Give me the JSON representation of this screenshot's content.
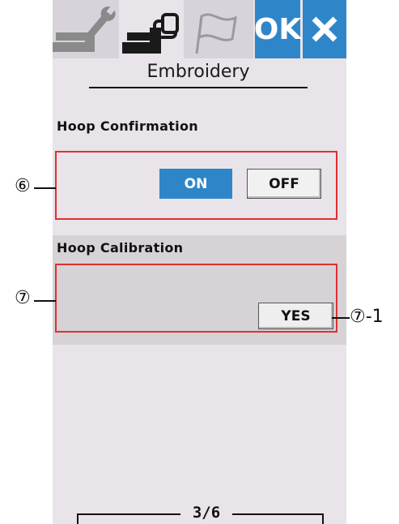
{
  "tabs": [
    {
      "name": "settings-tab",
      "icon": "sewing-machine-wrench-icon",
      "active": false
    },
    {
      "name": "embroidery-tab",
      "icon": "embroidery-machine-icon",
      "active": true
    },
    {
      "name": "language-tab",
      "icon": "flag-icon",
      "active": false
    }
  ],
  "toolbar": {
    "ok_label": "OK",
    "close_icon": "close-icon"
  },
  "page": {
    "title": "Embroidery"
  },
  "hoop_confirmation": {
    "label": "Hoop Confirmation",
    "on_label": "ON",
    "off_label": "OFF",
    "selected": "ON"
  },
  "hoop_calibration": {
    "label": "Hoop Calibration",
    "yes_label": "YES"
  },
  "callouts": {
    "c6": "⑥",
    "c7": "⑦",
    "c7_1": "⑦-1"
  },
  "pagination": {
    "text": "3/6"
  },
  "colors": {
    "accent": "#2e86c9",
    "highlight_box": "#e03030",
    "background": "#e9e3ea"
  }
}
